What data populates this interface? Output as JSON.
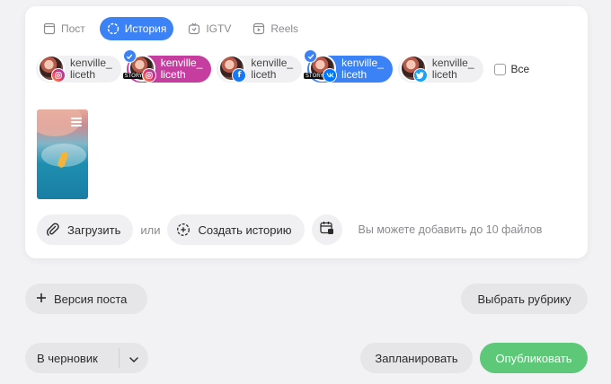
{
  "tabs": [
    {
      "label": "Пост",
      "icon": "post-icon",
      "active": false
    },
    {
      "label": "История",
      "icon": "story-ring-icon",
      "active": true
    },
    {
      "label": "IGTV",
      "icon": "igtv-icon",
      "active": false
    },
    {
      "label": "Reels",
      "icon": "reels-icon",
      "active": false
    }
  ],
  "accounts": [
    {
      "line1": "kenville_",
      "line2": "liceth",
      "network": "instagram",
      "selected": false,
      "story": false
    },
    {
      "line1": "kenville_",
      "line2": "liceth",
      "network": "instagram",
      "selected": true,
      "story": true,
      "story_tag": "STORY"
    },
    {
      "line1": "kenville_",
      "line2": "liceth",
      "network": "facebook",
      "selected": false,
      "story": false
    },
    {
      "line1": "kenville_",
      "line2": "liceth",
      "network": "vk",
      "selected": true,
      "story": true,
      "story_tag": "STORY"
    },
    {
      "line1": "kenville_",
      "line2": "liceth",
      "network": "twitter",
      "selected": false,
      "story": false
    }
  ],
  "select_all_label": "Все",
  "media": {
    "thumbnail": "surfer-photo"
  },
  "actions": {
    "upload_label": "Загрузить",
    "or_label": "или",
    "create_story_label": "Создать историю",
    "hint": "Вы можете добавить до 10 файлов"
  },
  "bottom": {
    "version_label": "Версия поста",
    "rubric_label": "Выбрать рубрику",
    "draft_label": "В черновик",
    "schedule_label": "Запланировать",
    "publish_label": "Опубликовать"
  },
  "colors": {
    "accent_blue": "#3b82f6",
    "instagram_selected": "#c53d9f",
    "publish_green": "#5cc878",
    "background": "#f2f2f4"
  }
}
